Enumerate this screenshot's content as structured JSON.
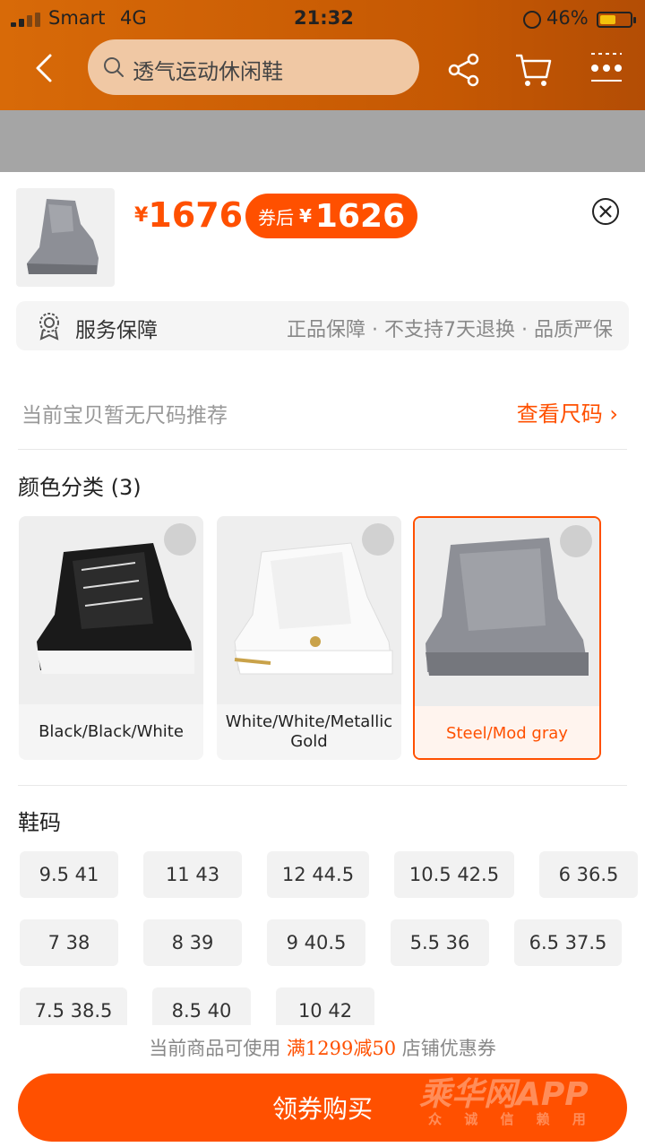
{
  "status": {
    "carrier": "Smart",
    "network": "4G",
    "time": "21:32",
    "battery": "46%",
    "battery_level": 0.46
  },
  "header": {
    "search_text": "透气运动休闲鞋"
  },
  "product": {
    "currency": "¥",
    "price": "1676",
    "coupon_label": "券后",
    "coupon_price": "1626"
  },
  "service": {
    "title": "服务保障",
    "desc": "正品保障 · 不支持7天退换 · 品质严保"
  },
  "size_rec": {
    "text": "当前宝贝暂无尺码推荐",
    "link": "查看尺码"
  },
  "colors": {
    "title": "颜色分类 (3)",
    "items": [
      {
        "name": "Black/Black/White",
        "selected": false
      },
      {
        "name": "White/White/Metallic Gold",
        "selected": false
      },
      {
        "name": "Steel/Mod gray",
        "selected": true
      }
    ]
  },
  "sizes": {
    "title": "鞋码",
    "items": [
      "9.5 41",
      "11 43",
      "12 44.5",
      "10.5 42.5",
      "6 36.5",
      "7 38",
      "8 39",
      "9 40.5",
      "5.5 36",
      "6.5 37.5",
      "7.5 38.5",
      "8.5 40",
      "10 42"
    ]
  },
  "promo": {
    "prefix": "当前商品可使用 ",
    "highlight": "满1299减50",
    "suffix": " 店铺优惠券"
  },
  "buy_button": "领券购买",
  "watermark": {
    "main": "乘华网APP",
    "sub": "众 诚 信 赖 用"
  },
  "colors_theme": {
    "accent": "#ff5000",
    "header": "#c55803"
  }
}
